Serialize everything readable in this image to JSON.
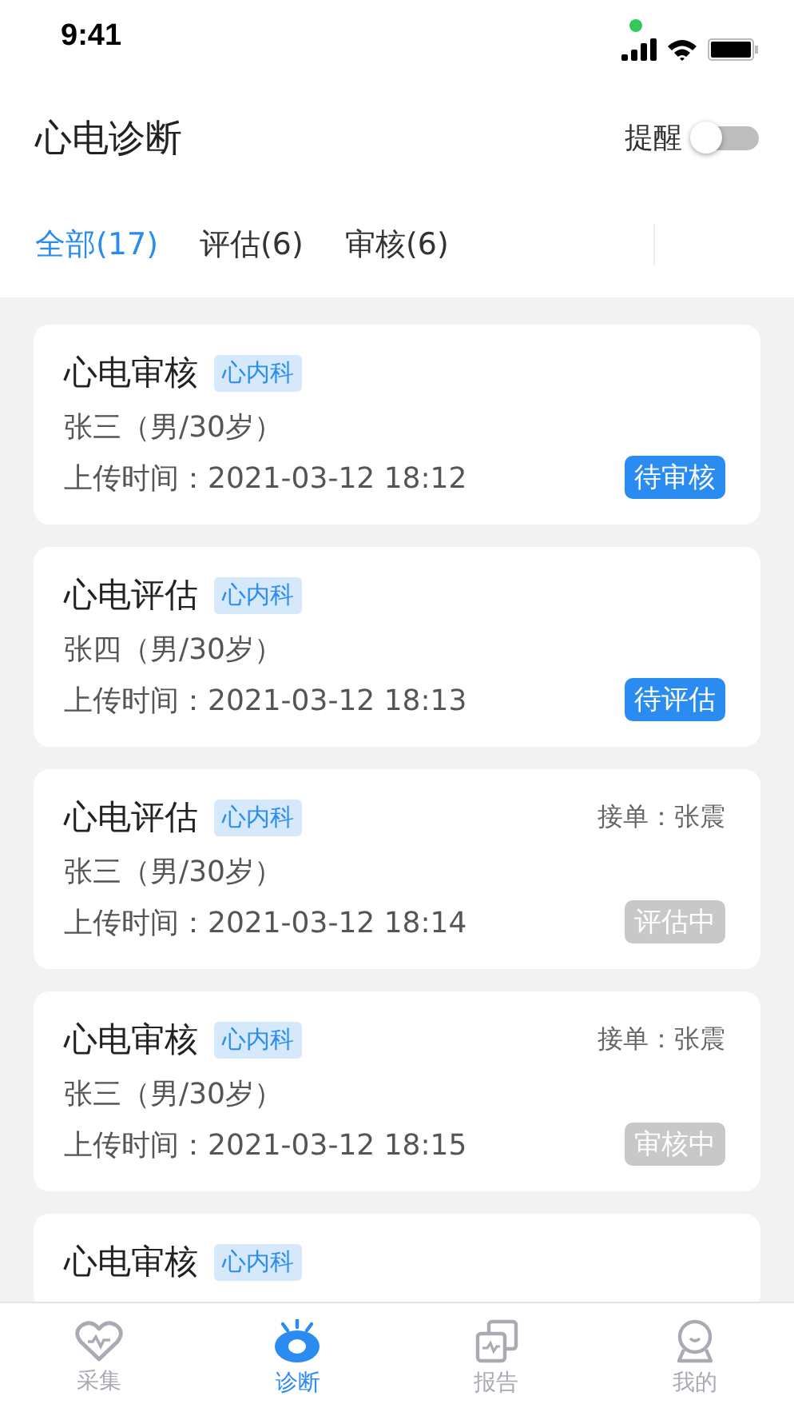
{
  "status_bar": {
    "time": "9:41"
  },
  "header": {
    "title": "心电诊断",
    "reminder": {
      "label": "提醒",
      "on": false
    }
  },
  "tabs": [
    {
      "label": "全部(17)",
      "selected": true
    },
    {
      "label": "评估(6)",
      "selected": false
    },
    {
      "label": "审核(6)",
      "selected": false
    }
  ],
  "cards": [
    {
      "title": "心电审核",
      "tag": "心内科",
      "patient": "张三（男/30岁）",
      "upload_time": "上传时间：2021-03-12 18:12",
      "status": {
        "label": "待审核",
        "kind": "pending"
      }
    },
    {
      "title": "心电评估",
      "tag": "心内科",
      "patient": "张四（男/30岁）",
      "upload_time": "上传时间：2021-03-12 18:13",
      "status": {
        "label": "待评估",
        "kind": "pending"
      }
    },
    {
      "title": "心电评估",
      "tag": "心内科",
      "assignee": "接单：张震",
      "patient": "张三（男/30岁）",
      "upload_time": "上传时间：2021-03-12 18:14",
      "status": {
        "label": "评估中",
        "kind": "in_progress"
      }
    },
    {
      "title": "心电审核",
      "tag": "心内科",
      "assignee": "接单：张震",
      "patient": "张三（男/30岁）",
      "upload_time": "上传时间：2021-03-12 18:15",
      "status": {
        "label": "审核中",
        "kind": "in_progress"
      }
    },
    {
      "title": "心电审核",
      "tag": "心内科"
    }
  ],
  "tab_bar": [
    {
      "label": "采集",
      "kind": "heart",
      "selected": false
    },
    {
      "label": "诊断",
      "kind": "eye",
      "selected": true
    },
    {
      "label": "报告",
      "kind": "report",
      "selected": false
    },
    {
      "label": "我的",
      "kind": "person",
      "selected": false
    }
  ]
}
